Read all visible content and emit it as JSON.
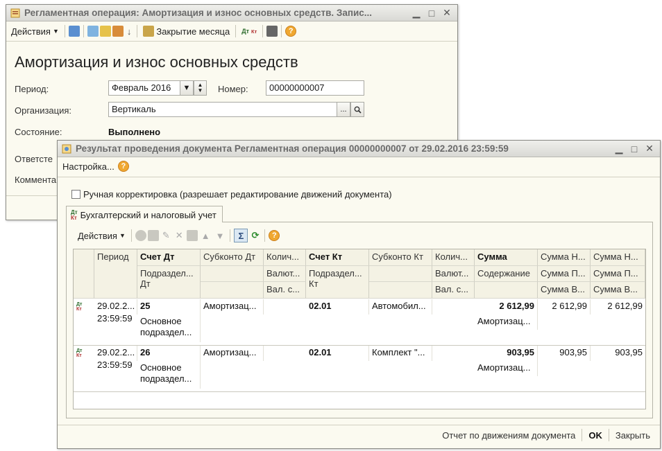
{
  "back_window": {
    "title": "Регламентная операция: Амортизация и износ основных средств. Запис...",
    "toolbar": {
      "actions_label": "Действия",
      "close_month_label": "Закрытие месяца"
    },
    "heading": "Амортизация и износ основных средств",
    "period_label": "Период:",
    "period_value": "Февраль 2016",
    "number_label": "Номер:",
    "number_value": "00000000007",
    "org_label": "Организация:",
    "org_value": "Вертикаль",
    "state_label": "Состояние:",
    "state_value": "Выполнено",
    "responsible_label": "Ответсте",
    "comment_label": "Коммента"
  },
  "front_window": {
    "title": "Результат проведения документа Регламентная операция 00000000007 от 29.02.2016 23:59:59",
    "settings_label": "Настройка...",
    "manual_checkbox_label": "Ручная корректировка (разрешает редактирование движений документа)",
    "tab_label": "Бухгалтерский и налоговый учет",
    "grid_actions_label": "Действия",
    "columns": {
      "period": "Период",
      "debit_account": "Счет Дт",
      "debit_sub": "Подраздел... Дт",
      "subconto_dt": "Субконто Дт",
      "qty_dt": "Колич...",
      "currency_dt": "Валют...",
      "cur_sum_dt": "Вал. с...",
      "credit_account": "Счет Кт",
      "credit_sub": "Подраздел... Кт",
      "subconto_kt": "Субконто Кт",
      "qty_kt": "Колич...",
      "currency_kt": "Валют...",
      "cur_sum_kt": "Вал. с...",
      "sum": "Сумма",
      "content": "Содержание",
      "sum_n1": "Сумма Н...",
      "sum_p1": "Сумма П...",
      "sum_v1": "Сумма В...",
      "sum_n2": "Сумма Н...",
      "sum_p2": "Сумма П...",
      "sum_v2": "Сумма В..."
    },
    "rows": [
      {
        "period": "29.02.2...",
        "time": "23:59:59",
        "debit": "25",
        "debit_sub": "Основное подраздел...",
        "subconto_dt": "Амортизац...",
        "credit": "02.01",
        "subconto_kt": "Автомобил...",
        "sum": "2 612,99",
        "content": "Амортизац...",
        "sum_n": "2 612,99",
        "sum_n2": "2 612,99"
      },
      {
        "period": "29.02.2...",
        "time": "23:59:59",
        "debit": "26",
        "debit_sub": "Основное подраздел...",
        "subconto_dt": "Амортизац...",
        "credit": "02.01",
        "subconto_kt": "Комплект \"...",
        "sum": "903,95",
        "content": "Амортизац...",
        "sum_n": "903,95",
        "sum_n2": "903,95"
      }
    ],
    "footer": {
      "report_label": "Отчет по движениям документа",
      "ok_label": "OK",
      "close_label": "Закрыть"
    }
  },
  "colors": {
    "window_bg": "#fbfaf0",
    "title_text": "#6a6a6a",
    "header_bg": "#f4f2e4",
    "help_orange": "#f0a830"
  }
}
